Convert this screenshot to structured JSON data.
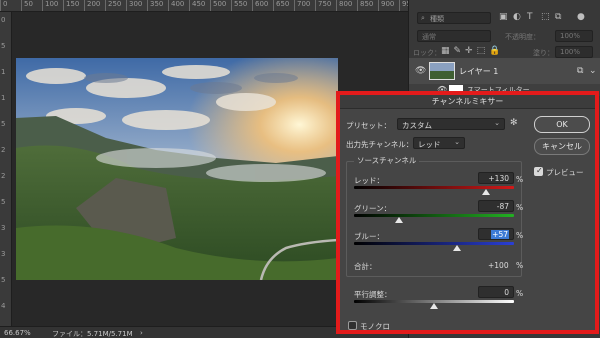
{
  "ruler": {
    "top_ticks": [
      "0",
      "50",
      "100",
      "150",
      "200",
      "250",
      "300",
      "350",
      "400",
      "450",
      "500",
      "550",
      "600",
      "650",
      "700",
      "750",
      "800",
      "850",
      "900",
      "950"
    ],
    "left_ticks": [
      "0",
      "5",
      "1",
      "1",
      "5",
      "2",
      "2",
      "5",
      "3",
      "3",
      "5",
      "4"
    ]
  },
  "status": {
    "zoom": "66.67%",
    "file_info": "ファイル：5.71M/5.71M",
    "arrow": "›"
  },
  "layers_panel": {
    "search_placeholder": "種類",
    "blend_mode": "通常",
    "opacity_label": "不透明度：",
    "opacity_value": "100%",
    "lock_label": "ロック：",
    "fill_label": "塗り：",
    "fill_value": "100%",
    "layer_name": "レイヤー 1",
    "smart_filter_label": "スマートフィルター"
  },
  "dialog": {
    "title": "チャンネルミキサー",
    "preset_label": "プリセット：",
    "preset_value": "カスタム",
    "output_label": "出力先チャンネル：",
    "output_value": "レッド",
    "ok_label": "OK",
    "cancel_label": "キャンセル",
    "preview_label": "プレビュー",
    "preview_checked": true,
    "source_group_title": "ソースチャンネル",
    "red_label": "レッド：",
    "red_value": "+130",
    "green_label": "グリーン：",
    "green_value": "-87",
    "blue_label": "ブルー：",
    "blue_value": "+57",
    "total_label": "合計：",
    "total_value": "+100",
    "constant_label": "平行調整：",
    "constant_value": "0",
    "percent": "%",
    "mono_label": "モノクロ",
    "mono_checked": false,
    "slider_levels": {
      "red": 130,
      "green": -87,
      "blue": 57,
      "constant": 0
    },
    "slider_range": [
      -200,
      200
    ],
    "constant_range": [
      -200,
      200
    ]
  },
  "colors": {
    "highlight_border": "#e31b1b",
    "selection": "#3d7bd6"
  }
}
